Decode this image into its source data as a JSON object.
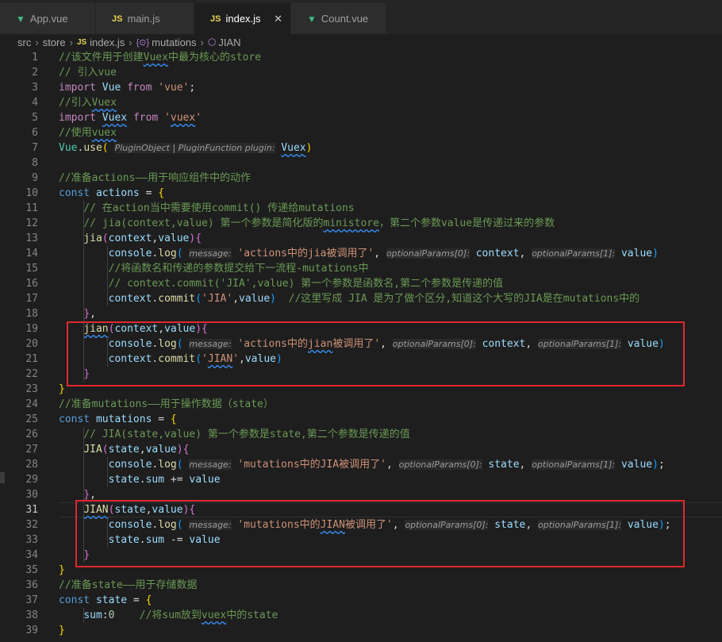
{
  "tabs": [
    {
      "icon": "vue-icon",
      "glyph": "▼",
      "label": "App.vue",
      "active": false
    },
    {
      "icon": "js-file-icon",
      "glyph": "JS",
      "label": "main.js",
      "active": false
    },
    {
      "icon": "js-file-icon",
      "glyph": "JS",
      "label": "index.js",
      "active": true
    },
    {
      "icon": "vue-icon",
      "glyph": "▼",
      "label": "Count.vue",
      "active": false
    }
  ],
  "close_glyph": "✕",
  "breadcrumb": {
    "parts": [
      "src",
      "store",
      "index.js",
      "mutations",
      "JIAN"
    ],
    "js_glyph": "JS",
    "object_glyph": "{⊙}",
    "cube_glyph": "⬡",
    "separator": "›"
  },
  "active_line": 31,
  "lines": [
    {
      "n": 1,
      "t": [
        [
          "c",
          "//该文件用于创建"
        ],
        [
          "c sq",
          "Vuex"
        ],
        [
          "c",
          "中最为核心的store"
        ]
      ]
    },
    {
      "n": 2,
      "t": [
        [
          "c",
          "// 引入vue"
        ]
      ]
    },
    {
      "n": 3,
      "t": [
        [
          "kc",
          "import"
        ],
        [
          "p",
          " "
        ],
        [
          "v",
          "Vue"
        ],
        [
          "p",
          " "
        ],
        [
          "kc",
          "from"
        ],
        [
          "p",
          " "
        ],
        [
          "s",
          "'vue'"
        ],
        [
          "p",
          ";"
        ]
      ]
    },
    {
      "n": 4,
      "t": [
        [
          "c",
          "//引入"
        ],
        [
          "c sq",
          "Vuex"
        ]
      ]
    },
    {
      "n": 5,
      "t": [
        [
          "kc",
          "import"
        ],
        [
          "p",
          " "
        ],
        [
          "v sq",
          "Vuex"
        ],
        [
          "p",
          " "
        ],
        [
          "kc",
          "from"
        ],
        [
          "p",
          " "
        ],
        [
          "s",
          "'"
        ],
        [
          "s sq",
          "vuex"
        ],
        [
          "s",
          "'"
        ]
      ]
    },
    {
      "n": 6,
      "t": [
        [
          "c",
          "//使用"
        ],
        [
          "c sq",
          "vuex"
        ]
      ]
    },
    {
      "n": 7,
      "t": [
        [
          "cl",
          "Vue"
        ],
        [
          "p",
          "."
        ],
        [
          "f",
          "use"
        ],
        [
          "br1",
          "("
        ],
        [
          "p",
          " "
        ],
        [
          "h",
          "PluginObject | PluginFunction plugin:"
        ],
        [
          "p",
          " "
        ],
        [
          "v sq",
          "Vuex"
        ],
        [
          "br1",
          ")"
        ]
      ]
    },
    {
      "n": 8,
      "t": []
    },
    {
      "n": 9,
      "t": [
        [
          "c",
          "//准备actions——用于响应组件中的动作"
        ]
      ]
    },
    {
      "n": 10,
      "t": [
        [
          "k",
          "const"
        ],
        [
          "p",
          " "
        ],
        [
          "v",
          "actions"
        ],
        [
          "p",
          " = "
        ],
        [
          "br1",
          "{"
        ]
      ]
    },
    {
      "n": 11,
      "g": [
        106
      ],
      "t": [
        [
          "p",
          "    "
        ],
        [
          "c",
          "// 在action当中需要使用commit() 传递给mutations"
        ]
      ]
    },
    {
      "n": 12,
      "g": [
        106
      ],
      "t": [
        [
          "p",
          "    "
        ],
        [
          "c",
          "// jia(context,value) 第一个参数是简化版的"
        ],
        [
          "c sq",
          "ministore"
        ],
        [
          "c",
          "，第二个参数value是传递过来的参数"
        ]
      ]
    },
    {
      "n": 13,
      "g": [
        106
      ],
      "t": [
        [
          "p",
          "    "
        ],
        [
          "f",
          "jia"
        ],
        [
          "br2",
          "("
        ],
        [
          "v",
          "context"
        ],
        [
          "p",
          ","
        ],
        [
          "v",
          "value"
        ],
        [
          "br2",
          ")"
        ],
        [
          "br2",
          "{"
        ]
      ]
    },
    {
      "n": 14,
      "g": [
        106,
        136
      ],
      "t": [
        [
          "p",
          "        "
        ],
        [
          "v",
          "console"
        ],
        [
          "p",
          "."
        ],
        [
          "f",
          "log"
        ],
        [
          "br3",
          "("
        ],
        [
          "p",
          " "
        ],
        [
          "h",
          "message:"
        ],
        [
          "p",
          " "
        ],
        [
          "s",
          "'actions中的jia被调用了'"
        ],
        [
          "p",
          ", "
        ],
        [
          "h",
          "optionalParams[0]:"
        ],
        [
          "p",
          " "
        ],
        [
          "v",
          "context"
        ],
        [
          "p",
          ", "
        ],
        [
          "h",
          "optionalParams[1]:"
        ],
        [
          "p",
          " "
        ],
        [
          "v",
          "value"
        ],
        [
          "br3",
          ")"
        ]
      ]
    },
    {
      "n": 15,
      "g": [
        106,
        136
      ],
      "t": [
        [
          "p",
          "        "
        ],
        [
          "c",
          "//将函数名和传递的参数提交给下一流程-mutations中"
        ]
      ]
    },
    {
      "n": 16,
      "g": [
        106,
        136
      ],
      "t": [
        [
          "p",
          "        "
        ],
        [
          "c",
          "// context.commit('JIA',value) 第一个参数是函数名,第二个参数是传递的值"
        ]
      ]
    },
    {
      "n": 17,
      "g": [
        106,
        136
      ],
      "t": [
        [
          "p",
          "        "
        ],
        [
          "v",
          "context"
        ],
        [
          "p",
          "."
        ],
        [
          "f",
          "commit"
        ],
        [
          "br3",
          "("
        ],
        [
          "s",
          "'JIA'"
        ],
        [
          "p",
          ","
        ],
        [
          "v",
          "value"
        ],
        [
          "br3",
          ")"
        ],
        [
          "p",
          "  "
        ],
        [
          "c",
          "//这里写成 JIA 是为了做个区分,知道这个大写的JIA是在mutations中的"
        ]
      ]
    },
    {
      "n": 18,
      "g": [
        106
      ],
      "t": [
        [
          "p",
          "    "
        ],
        [
          "br2",
          "}"
        ],
        [
          "p",
          ","
        ]
      ]
    },
    {
      "n": 19,
      "g": [
        106
      ],
      "t": [
        [
          "p",
          "    "
        ],
        [
          "f sq",
          "jian"
        ],
        [
          "br2",
          "("
        ],
        [
          "v",
          "context"
        ],
        [
          "p",
          ","
        ],
        [
          "v",
          "value"
        ],
        [
          "br2",
          ")"
        ],
        [
          "br2",
          "{"
        ]
      ]
    },
    {
      "n": 20,
      "g": [
        106,
        136
      ],
      "t": [
        [
          "p",
          "        "
        ],
        [
          "v",
          "console"
        ],
        [
          "p",
          "."
        ],
        [
          "f",
          "log"
        ],
        [
          "br3",
          "("
        ],
        [
          "p",
          " "
        ],
        [
          "h",
          "message:"
        ],
        [
          "p",
          " "
        ],
        [
          "s",
          "'actions中的"
        ],
        [
          "s sq",
          "jian"
        ],
        [
          "s",
          "被调用了'"
        ],
        [
          "p",
          ", "
        ],
        [
          "h",
          "optionalParams[0]:"
        ],
        [
          "p",
          " "
        ],
        [
          "v",
          "context"
        ],
        [
          "p",
          ", "
        ],
        [
          "h",
          "optionalParams[1]:"
        ],
        [
          "p",
          " "
        ],
        [
          "v",
          "value"
        ],
        [
          "br3",
          ")"
        ]
      ]
    },
    {
      "n": 21,
      "g": [
        106,
        136
      ],
      "t": [
        [
          "p",
          "        "
        ],
        [
          "v",
          "context"
        ],
        [
          "p",
          "."
        ],
        [
          "f",
          "commit"
        ],
        [
          "br3",
          "("
        ],
        [
          "s",
          "'"
        ],
        [
          "s sq",
          "JIAN"
        ],
        [
          "s",
          "'"
        ],
        [
          "p",
          ","
        ],
        [
          "v",
          "value"
        ],
        [
          "br3",
          ")"
        ]
      ]
    },
    {
      "n": 22,
      "g": [
        106
      ],
      "t": [
        [
          "p",
          "    "
        ],
        [
          "br2",
          "}"
        ]
      ]
    },
    {
      "n": 23,
      "t": [
        [
          "br1",
          "}"
        ]
      ]
    },
    {
      "n": 24,
      "t": [
        [
          "c",
          "//准备mutations——用于操作数据（state）"
        ]
      ]
    },
    {
      "n": 25,
      "t": [
        [
          "k",
          "const"
        ],
        [
          "p",
          " "
        ],
        [
          "v",
          "mutations"
        ],
        [
          "p",
          " = "
        ],
        [
          "br1",
          "{"
        ]
      ]
    },
    {
      "n": 26,
      "g": [
        106
      ],
      "t": [
        [
          "p",
          "    "
        ],
        [
          "c",
          "// JIA(state,value) 第一个参数是state,第二个参数是传递的值"
        ]
      ]
    },
    {
      "n": 27,
      "g": [
        106
      ],
      "t": [
        [
          "p",
          "    "
        ],
        [
          "f",
          "JIA"
        ],
        [
          "br2",
          "("
        ],
        [
          "v",
          "state"
        ],
        [
          "p",
          ","
        ],
        [
          "v",
          "value"
        ],
        [
          "br2",
          ")"
        ],
        [
          "br2",
          "{"
        ]
      ]
    },
    {
      "n": 28,
      "g": [
        106,
        136
      ],
      "t": [
        [
          "p",
          "        "
        ],
        [
          "v",
          "console"
        ],
        [
          "p",
          "."
        ],
        [
          "f",
          "log"
        ],
        [
          "br3",
          "("
        ],
        [
          "p",
          " "
        ],
        [
          "h",
          "message:"
        ],
        [
          "p",
          " "
        ],
        [
          "s",
          "'mutations中的JIA被调用了'"
        ],
        [
          "p",
          ", "
        ],
        [
          "h",
          "optionalParams[0]:"
        ],
        [
          "p",
          " "
        ],
        [
          "v",
          "state"
        ],
        [
          "p",
          ", "
        ],
        [
          "h",
          "optionalParams[1]:"
        ],
        [
          "p",
          " "
        ],
        [
          "v",
          "value"
        ],
        [
          "br3",
          ")"
        ],
        [
          "p",
          ";"
        ]
      ]
    },
    {
      "n": 29,
      "g": [
        106,
        136
      ],
      "t": [
        [
          "p",
          "        "
        ],
        [
          "v",
          "state"
        ],
        [
          "p",
          "."
        ],
        [
          "v",
          "sum"
        ],
        [
          "p",
          " += "
        ],
        [
          "v",
          "value"
        ]
      ]
    },
    {
      "n": 30,
      "g": [
        106
      ],
      "t": [
        [
          "p",
          "    "
        ],
        [
          "br2",
          "}"
        ],
        [
          "p",
          ","
        ]
      ]
    },
    {
      "n": 31,
      "g": [
        106
      ],
      "t": [
        [
          "p",
          "    "
        ],
        [
          "f sq",
          "JIAN"
        ],
        [
          "br2",
          "("
        ],
        [
          "v",
          "state"
        ],
        [
          "p",
          ","
        ],
        [
          "v",
          "value"
        ],
        [
          "br2",
          ")"
        ],
        [
          "br2",
          "{"
        ]
      ]
    },
    {
      "n": 32,
      "g": [
        106,
        136
      ],
      "t": [
        [
          "p",
          "        "
        ],
        [
          "v",
          "console"
        ],
        [
          "p",
          "."
        ],
        [
          "f",
          "log"
        ],
        [
          "br3",
          "("
        ],
        [
          "p",
          " "
        ],
        [
          "h",
          "message:"
        ],
        [
          "p",
          " "
        ],
        [
          "s",
          "'mutations中的"
        ],
        [
          "s sq",
          "JIAN"
        ],
        [
          "s",
          "被调用了'"
        ],
        [
          "p",
          ", "
        ],
        [
          "h",
          "optionalParams[0]:"
        ],
        [
          "p",
          " "
        ],
        [
          "v",
          "state"
        ],
        [
          "p",
          ", "
        ],
        [
          "h",
          "optionalParams[1]:"
        ],
        [
          "p",
          " "
        ],
        [
          "v",
          "value"
        ],
        [
          "br3",
          ")"
        ],
        [
          "p",
          ";"
        ]
      ]
    },
    {
      "n": 33,
      "g": [
        106,
        136
      ],
      "t": [
        [
          "p",
          "        "
        ],
        [
          "v",
          "state"
        ],
        [
          "p",
          "."
        ],
        [
          "v",
          "sum"
        ],
        [
          "p",
          " -= "
        ],
        [
          "v",
          "value"
        ]
      ]
    },
    {
      "n": 34,
      "g": [
        106
      ],
      "t": [
        [
          "p",
          "    "
        ],
        [
          "br2",
          "}"
        ]
      ]
    },
    {
      "n": 35,
      "t": [
        [
          "br1",
          "}"
        ]
      ]
    },
    {
      "n": 36,
      "t": [
        [
          "c",
          "//准备state——用于存储数据"
        ]
      ]
    },
    {
      "n": 37,
      "t": [
        [
          "k",
          "const"
        ],
        [
          "p",
          " "
        ],
        [
          "v",
          "state"
        ],
        [
          "p",
          " = "
        ],
        [
          "br1",
          "{"
        ]
      ]
    },
    {
      "n": 38,
      "g": [
        106
      ],
      "t": [
        [
          "p",
          "    "
        ],
        [
          "v",
          "sum"
        ],
        [
          "p",
          ":"
        ],
        [
          "n",
          "0"
        ],
        [
          "p",
          "    "
        ],
        [
          "c",
          "//将sum放到"
        ],
        [
          "c sq",
          "vuex"
        ],
        [
          "c",
          "中的state"
        ]
      ]
    },
    {
      "n": 39,
      "t": [
        [
          "br1",
          "}"
        ]
      ]
    }
  ]
}
